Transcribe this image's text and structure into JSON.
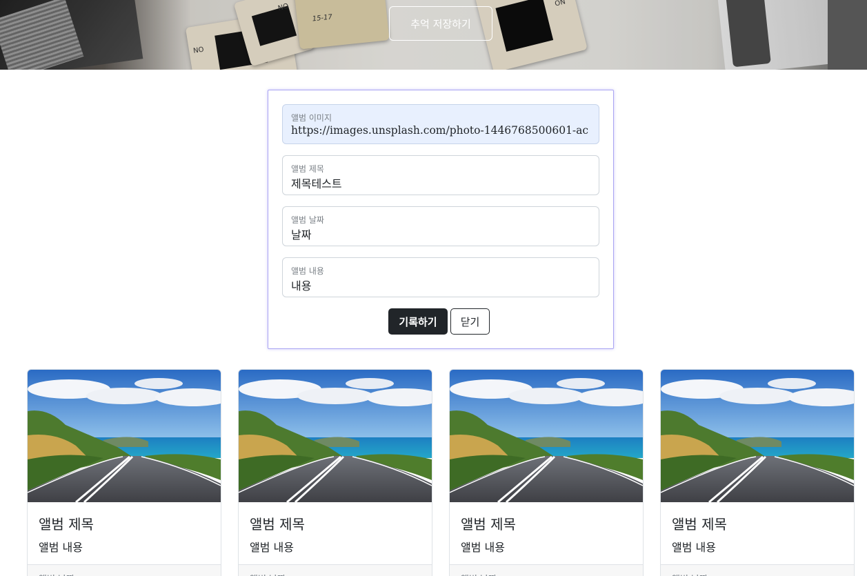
{
  "hero": {
    "button_label": "추억 저장하기",
    "slide_labels": [
      "NO",
      "NO",
      "ON",
      "15-17"
    ]
  },
  "form": {
    "fields": [
      {
        "label": "앨범 이미지",
        "value": "https://images.unsplash.com/photo-1446768500601-ac"
      },
      {
        "label": "앨범 제목",
        "value": "제목테스트"
      },
      {
        "label": "앨범 날짜",
        "value": "날짜"
      },
      {
        "label": "앨범 내용",
        "value": "내용"
      }
    ],
    "submit_label": "기록하기",
    "close_label": "닫기"
  },
  "albums": [
    {
      "title": "앨범 제목",
      "text": "앨범 내용",
      "footer": "앨범 날짜"
    },
    {
      "title": "앨범 제목",
      "text": "앨범 내용",
      "footer": "앨범 날짜"
    },
    {
      "title": "앨범 제목",
      "text": "앨범 내용",
      "footer": "앨범 날짜"
    },
    {
      "title": "앨범 제목",
      "text": "앨범 내용",
      "footer": "앨범 날짜"
    }
  ],
  "colors": {
    "primary_button": "#212529",
    "form_focus_border": "#a9a4f2",
    "autofill_bg": "#e8f0fe"
  }
}
